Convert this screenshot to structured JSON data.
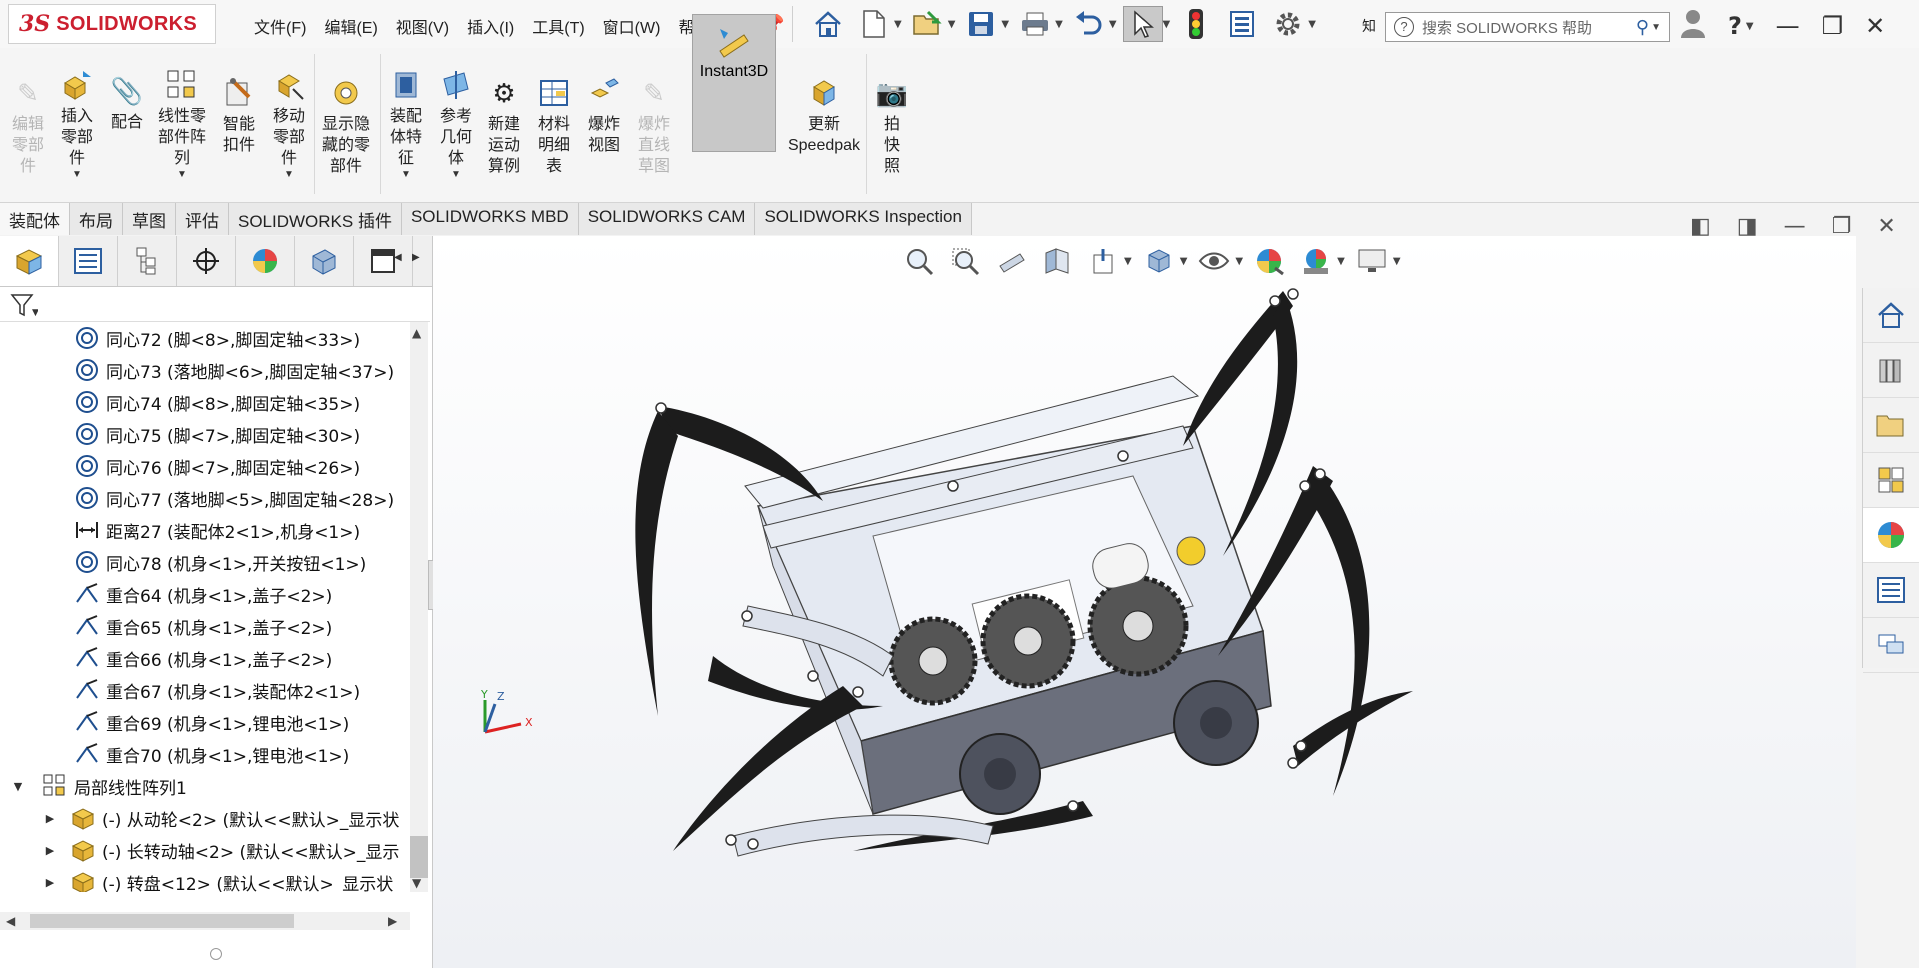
{
  "app": {
    "logo_mark": "3S",
    "logo_text": "SOLIDWORKS"
  },
  "menu": [
    "文件(F)",
    "编辑(E)",
    "视图(V)",
    "插入(I)",
    "工具(T)",
    "窗口(W)",
    "帮助(H)"
  ],
  "search": {
    "placeholder": "搜索 SOLIDWORKS 帮助",
    "prefix_label": "知"
  },
  "quick_access": [
    "home-icon",
    "new-document-icon",
    "open-icon",
    "save-icon",
    "print-icon",
    "undo-icon",
    "select-icon",
    "traffic-light-icon",
    "file-properties-icon",
    "options-gear-icon"
  ],
  "ribbon": {
    "commands": [
      {
        "label": "编辑零部件",
        "enabled": false
      },
      {
        "label": "插入零部件",
        "enabled": true
      },
      {
        "label": "配合",
        "enabled": true
      },
      {
        "label": "线性零部件阵列",
        "enabled": true
      },
      {
        "label": "智能扣件",
        "enabled": true
      },
      {
        "label": "移动零部件",
        "enabled": true
      },
      {
        "label": "显示隐藏的零部件",
        "enabled": true
      },
      {
        "label": "装配体特征",
        "enabled": true
      },
      {
        "label": "参考几何体",
        "enabled": true
      },
      {
        "label": "新建运动算例",
        "enabled": true
      },
      {
        "label": "材料明细表",
        "enabled": true
      },
      {
        "label": "爆炸视图",
        "enabled": true
      },
      {
        "label": "爆炸直线草图",
        "enabled": false
      },
      {
        "label": "Instant3D",
        "enabled": true,
        "active": true
      },
      {
        "label": "更新Speedpak",
        "enabled": true
      },
      {
        "label": "拍快照",
        "enabled": true
      }
    ]
  },
  "tabs": [
    {
      "label": "装配体",
      "active": true
    },
    {
      "label": "布局"
    },
    {
      "label": "草图"
    },
    {
      "label": "评估"
    },
    {
      "label": "SOLIDWORKS 插件"
    },
    {
      "label": "SOLIDWORKS MBD"
    },
    {
      "label": "SOLIDWORKS CAM"
    },
    {
      "label": "SOLIDWORKS Inspection"
    }
  ],
  "tree": {
    "items": [
      {
        "icon": "concentric-icon",
        "text": "同心72 (脚<8>,脚固定轴<33>)"
      },
      {
        "icon": "concentric-icon",
        "text": "同心73 (落地脚<6>,脚固定轴<37>)"
      },
      {
        "icon": "concentric-icon",
        "text": "同心74 (脚<8>,脚固定轴<35>)"
      },
      {
        "icon": "concentric-icon",
        "text": "同心75 (脚<7>,脚固定轴<30>)"
      },
      {
        "icon": "concentric-icon",
        "text": "同心76 (脚<7>,脚固定轴<26>)"
      },
      {
        "icon": "concentric-icon",
        "text": "同心77 (落地脚<5>,脚固定轴<28>)"
      },
      {
        "icon": "distance-icon",
        "text": "距离27 (装配体2<1>,机身<1>)"
      },
      {
        "icon": "concentric-icon",
        "text": "同心78 (机身<1>,开关按钮<1>)"
      },
      {
        "icon": "coincident-icon",
        "text": "重合64 (机身<1>,盖子<2>)"
      },
      {
        "icon": "coincident-icon",
        "text": "重合65 (机身<1>,盖子<2>)"
      },
      {
        "icon": "coincident-icon",
        "text": "重合66 (机身<1>,盖子<2>)"
      },
      {
        "icon": "coincident-icon",
        "text": "重合67 (机身<1>,装配体2<1>)"
      },
      {
        "icon": "coincident-icon",
        "text": "重合69 (机身<1>,锂电池<1>)"
      },
      {
        "icon": "coincident-icon",
        "text": "重合70 (机身<1>,锂电池<1>)"
      },
      {
        "icon": "linear-pattern-icon",
        "text": "局部线性阵列1",
        "expanded": true
      },
      {
        "icon": "part-icon",
        "text": "(-) 从动轮<2> (默认<<默认>_显示状"
      },
      {
        "icon": "part-icon",
        "text": "(-) 长转动轴<2> (默认<<默认>_显示"
      },
      {
        "icon": "part-icon",
        "text": "(-) 转盘<12> (默认<<默认>_显示状"
      }
    ]
  },
  "triad": {
    "x": "X",
    "y": "Y",
    "z": "Z"
  },
  "colors": {
    "accent": "#2d5fa0",
    "logo": "#cc1f2f",
    "selected": "#c8c8c8"
  }
}
